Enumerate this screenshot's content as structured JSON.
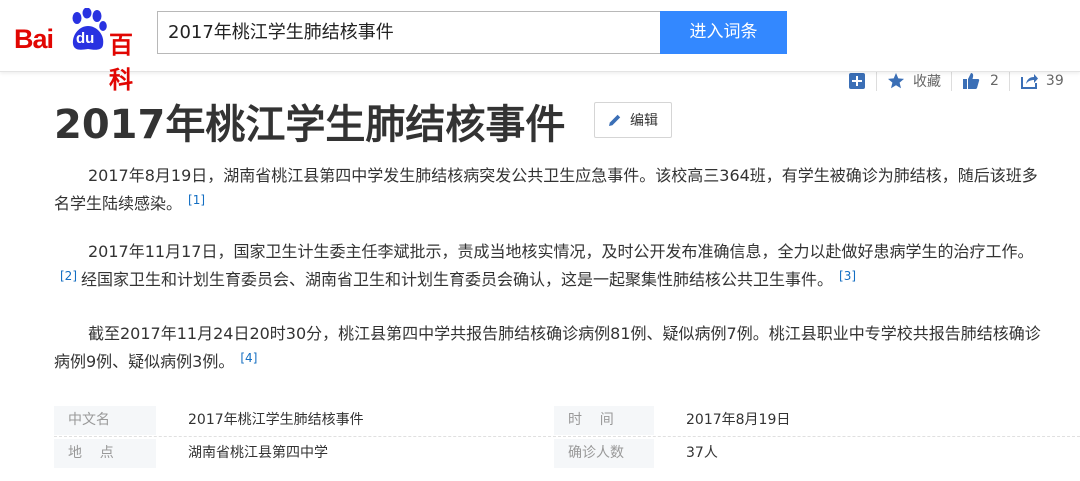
{
  "header": {
    "logo_text": "Bai",
    "logo_du": "du",
    "logo_baike": "百科",
    "search_value": "2017年桃江学生肺结核事件",
    "search_button": "进入词条"
  },
  "tools": {
    "favorite_label": "收藏",
    "like_count": "2",
    "share_count": "39"
  },
  "article": {
    "title": "2017年桃江学生肺结核事件",
    "edit_label": "编辑",
    "p1": "2017年8月19日，湖南省桃江县第四中学发生肺结核病突发公共卫生应急事件。该校高三364班，有学生被确诊为肺结核，随后该班多名学生陆续感染。",
    "p1_ref": "[1]",
    "p2a": "2017年11月17日，国家卫生计生委主任李斌批示，责成当地核实情况，及时公开发布准确信息，全力以赴做好患病学生的治疗工作。",
    "p2_ref1": "[2]",
    "p2b": "经国家卫生和计划生育委员会、湖南省卫生和计划生育委员会确认，这是一起聚集性肺结核公共卫生事件。",
    "p2_ref2": "[3]",
    "p3": "截至2017年11月24日20时30分，桃江县第四中学共报告肺结核确诊病例81例、疑似病例7例。桃江县职业中专学校共报告肺结核确诊病例9例、疑似病例3例。",
    "p3_ref": "[4]"
  },
  "infobox": {
    "rows": [
      {
        "left_label": "中文名",
        "left_value": "2017年桃江学生肺结核事件",
        "right_label": "时    间",
        "right_value": "2017年8月19日"
      },
      {
        "left_label": "地    点",
        "left_value": "湖南省桃江县第四中学",
        "right_label": "确诊人数",
        "right_value": "37人"
      }
    ]
  },
  "colors": {
    "brand_red": "#e10602",
    "brand_blue": "#2932e1",
    "button_blue": "#3388ff",
    "link_blue": "#136ec2"
  },
  "icons": [
    "baidu-paw-icon",
    "add-icon",
    "star-icon",
    "thumbs-up-icon",
    "share-icon",
    "pencil-icon"
  ]
}
